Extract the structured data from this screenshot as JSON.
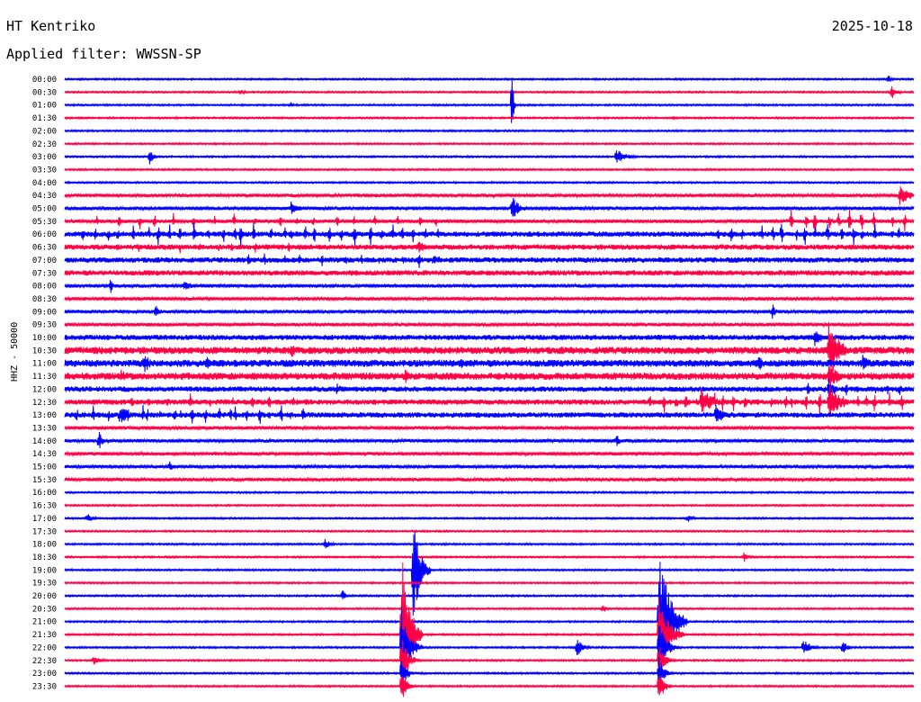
{
  "header": {
    "station": "HT Kentriko",
    "date": "2025-10-18",
    "filter_text": "Applied filter: WWSSN-SP",
    "channel_label": "HHZ - 50000"
  },
  "colors": {
    "blue": "#0000ff",
    "red": "#ff0044",
    "text": "#000000",
    "background": "#ffffff"
  },
  "chart_data": {
    "type": "line",
    "title": "HT Kentriko",
    "subtitle": "Applied filter: WWSSN-SP",
    "ylabel": "HHZ - 50000",
    "xlabel": "",
    "grid": false,
    "legend": "none",
    "x_range": [
      0,
      30
    ],
    "x_unit": "minutes",
    "color_cycle": [
      "blue",
      "red"
    ],
    "row_labels": [
      "00:00",
      "00:30",
      "01:00",
      "01:30",
      "02:00",
      "02:30",
      "03:00",
      "03:30",
      "04:00",
      "04:30",
      "05:00",
      "05:30",
      "06:00",
      "06:30",
      "07:00",
      "07:30",
      "08:00",
      "08:30",
      "09:00",
      "09:30",
      "10:00",
      "10:30",
      "11:00",
      "11:30",
      "12:00",
      "12:30",
      "13:00",
      "13:30",
      "14:00",
      "14:30",
      "15:00",
      "15:30",
      "16:00",
      "16:30",
      "17:00",
      "17:30",
      "18:00",
      "18:30",
      "19:00",
      "19:30",
      "20:00",
      "20:30",
      "21:00",
      "21:30",
      "22:00",
      "22:30",
      "23:00",
      "23:30"
    ],
    "row_noise": [
      1,
      1,
      1,
      1,
      1,
      1,
      1,
      1,
      1,
      2,
      2,
      2,
      3,
      3,
      3,
      3,
      2,
      2,
      2,
      2,
      3,
      4,
      4,
      4,
      3,
      3,
      3,
      2,
      2,
      2,
      2,
      2,
      1,
      1,
      1,
      1,
      1,
      1,
      1,
      1,
      1,
      1,
      1,
      1,
      1,
      1,
      1,
      1
    ],
    "events": [
      {
        "row": 1,
        "t": 29.2,
        "amp": 9,
        "decay": 0.4
      },
      {
        "row": 0,
        "t": 29.1,
        "amp": 6,
        "decay": 0.2
      },
      {
        "row": 2,
        "t": 8.0,
        "amp": 4,
        "decay": 0.2
      },
      {
        "row": 1,
        "t": 6.2,
        "amp": 3,
        "decay": 0.5
      },
      {
        "row": 3,
        "t": 21.5,
        "amp": 3,
        "decay": 0.2
      },
      {
        "row": 6,
        "t": 3.0,
        "amp": 9,
        "decay": 0.3
      },
      {
        "row": 6,
        "t": 19.5,
        "amp": 9,
        "decay": 0.8
      },
      {
        "row": 2,
        "t": 15.8,
        "amp": 45,
        "decay": 0.1
      },
      {
        "row": 10,
        "t": 15.8,
        "amp": 14,
        "decay": 0.6
      },
      {
        "row": 10,
        "t": 8.0,
        "amp": 8,
        "decay": 0.6
      },
      {
        "row": 9,
        "t": 29.5,
        "amp": 12,
        "decay": 0.8
      },
      {
        "row": 13,
        "t": 12.5,
        "amp": 7,
        "decay": 0.8
      },
      {
        "row": 14,
        "t": 13.0,
        "amp": 6,
        "decay": 1.2
      },
      {
        "row": 16,
        "t": 1.6,
        "amp": 10,
        "decay": 0.2
      },
      {
        "row": 16,
        "t": 4.2,
        "amp": 6,
        "decay": 1.0
      },
      {
        "row": 18,
        "t": 3.2,
        "amp": 8,
        "decay": 0.4
      },
      {
        "row": 18,
        "t": 25.0,
        "amp": 10,
        "decay": 0.3
      },
      {
        "row": 20,
        "t": 26.5,
        "amp": 10,
        "decay": 0.6
      },
      {
        "row": 21,
        "t": 8.0,
        "amp": 10,
        "decay": 0.4
      },
      {
        "row": 21,
        "t": 27.0,
        "amp": 36,
        "decay": 0.8
      },
      {
        "row": 22,
        "t": 2.8,
        "amp": 12,
        "decay": 0.5
      },
      {
        "row": 22,
        "t": 5.0,
        "amp": 10,
        "decay": 0.5
      },
      {
        "row": 22,
        "t": 14.0,
        "amp": 10,
        "decay": 0.4
      },
      {
        "row": 22,
        "t": 24.5,
        "amp": 10,
        "decay": 0.4
      },
      {
        "row": 22,
        "t": 28.2,
        "amp": 12,
        "decay": 0.5
      },
      {
        "row": 23,
        "t": 2.0,
        "amp": 9,
        "decay": 0.5
      },
      {
        "row": 23,
        "t": 5.4,
        "amp": 8,
        "decay": 0.4
      },
      {
        "row": 23,
        "t": 12.0,
        "amp": 10,
        "decay": 0.4
      },
      {
        "row": 23,
        "t": 27.0,
        "amp": 16,
        "decay": 0.8
      },
      {
        "row": 24,
        "t": 9.6,
        "amp": 8,
        "decay": 0.4
      },
      {
        "row": 24,
        "t": 27.0,
        "amp": 12,
        "decay": 0.6
      },
      {
        "row": 25,
        "t": 22.5,
        "amp": 16,
        "decay": 1.0
      },
      {
        "row": 25,
        "t": 27.0,
        "amp": 22,
        "decay": 0.8
      },
      {
        "row": 26,
        "t": 2.0,
        "amp": 12,
        "decay": 0.6
      },
      {
        "row": 26,
        "t": 23.0,
        "amp": 14,
        "decay": 0.6
      },
      {
        "row": 28,
        "t": 1.2,
        "amp": 12,
        "decay": 0.3
      },
      {
        "row": 28,
        "t": 19.5,
        "amp": 8,
        "decay": 0.3
      },
      {
        "row": 30,
        "t": 3.7,
        "amp": 6,
        "decay": 0.3
      },
      {
        "row": 34,
        "t": 0.8,
        "amp": 6,
        "decay": 0.5
      },
      {
        "row": 36,
        "t": 9.2,
        "amp": 6,
        "decay": 0.5
      },
      {
        "row": 34,
        "t": 22.0,
        "amp": 5,
        "decay": 0.5
      },
      {
        "row": 37,
        "t": 24.0,
        "amp": 6,
        "decay": 0.4
      },
      {
        "row": 40,
        "t": 9.8,
        "amp": 8,
        "decay": 0.3
      },
      {
        "row": 41,
        "t": 19.0,
        "amp": 6,
        "decay": 0.3
      },
      {
        "row": 43,
        "t": 11.9,
        "amp": 99,
        "decay": 0.6
      },
      {
        "row": 44,
        "t": 11.9,
        "amp": 46,
        "decay": 0.6
      },
      {
        "row": 45,
        "t": 11.9,
        "amp": 30,
        "decay": 0.5
      },
      {
        "row": 46,
        "t": 11.9,
        "amp": 20,
        "decay": 0.4
      },
      {
        "row": 47,
        "t": 11.9,
        "amp": 20,
        "decay": 0.4
      },
      {
        "row": 42,
        "t": 21.0,
        "amp": 90,
        "decay": 0.8
      },
      {
        "row": 43,
        "t": 21.0,
        "amp": 50,
        "decay": 0.7
      },
      {
        "row": 44,
        "t": 21.0,
        "amp": 30,
        "decay": 0.6
      },
      {
        "row": 45,
        "t": 21.0,
        "amp": 18,
        "decay": 0.5
      },
      {
        "row": 46,
        "t": 21.0,
        "amp": 20,
        "decay": 0.4
      },
      {
        "row": 47,
        "t": 21.0,
        "amp": 20,
        "decay": 0.4
      },
      {
        "row": 44,
        "t": 18.1,
        "amp": 10,
        "decay": 0.5
      },
      {
        "row": 44,
        "t": 26.1,
        "amp": 10,
        "decay": 0.6
      },
      {
        "row": 44,
        "t": 27.5,
        "amp": 8,
        "decay": 0.4
      },
      {
        "row": 45,
        "t": 1.0,
        "amp": 5,
        "decay": 0.8
      },
      {
        "row": 38,
        "t": 12.3,
        "amp": 70,
        "decay": 0.5
      }
    ],
    "swarms": [
      {
        "row": 12,
        "t_start": 0.5,
        "t_end": 13.5,
        "count": 30,
        "amp": 14
      },
      {
        "row": 12,
        "t_start": 23.0,
        "t_end": 29.8,
        "count": 16,
        "amp": 14
      },
      {
        "row": 11,
        "t_start": 0.8,
        "t_end": 13.5,
        "count": 18,
        "amp": 10
      },
      {
        "row": 11,
        "t_start": 25.5,
        "t_end": 29.8,
        "count": 10,
        "amp": 16
      },
      {
        "row": 13,
        "t_start": 1.0,
        "t_end": 9.0,
        "count": 12,
        "amp": 8
      },
      {
        "row": 14,
        "t_start": 6.0,
        "t_end": 13.0,
        "count": 10,
        "amp": 10
      },
      {
        "row": 26,
        "t_start": 0.2,
        "t_end": 8.6,
        "count": 22,
        "amp": 12
      },
      {
        "row": 25,
        "t_start": 2.0,
        "t_end": 9.0,
        "count": 10,
        "amp": 10
      },
      {
        "row": 25,
        "t_start": 20.5,
        "t_end": 29.8,
        "count": 22,
        "amp": 14
      },
      {
        "row": 24,
        "t_start": 26.0,
        "t_end": 29.8,
        "count": 8,
        "amp": 10
      }
    ]
  }
}
